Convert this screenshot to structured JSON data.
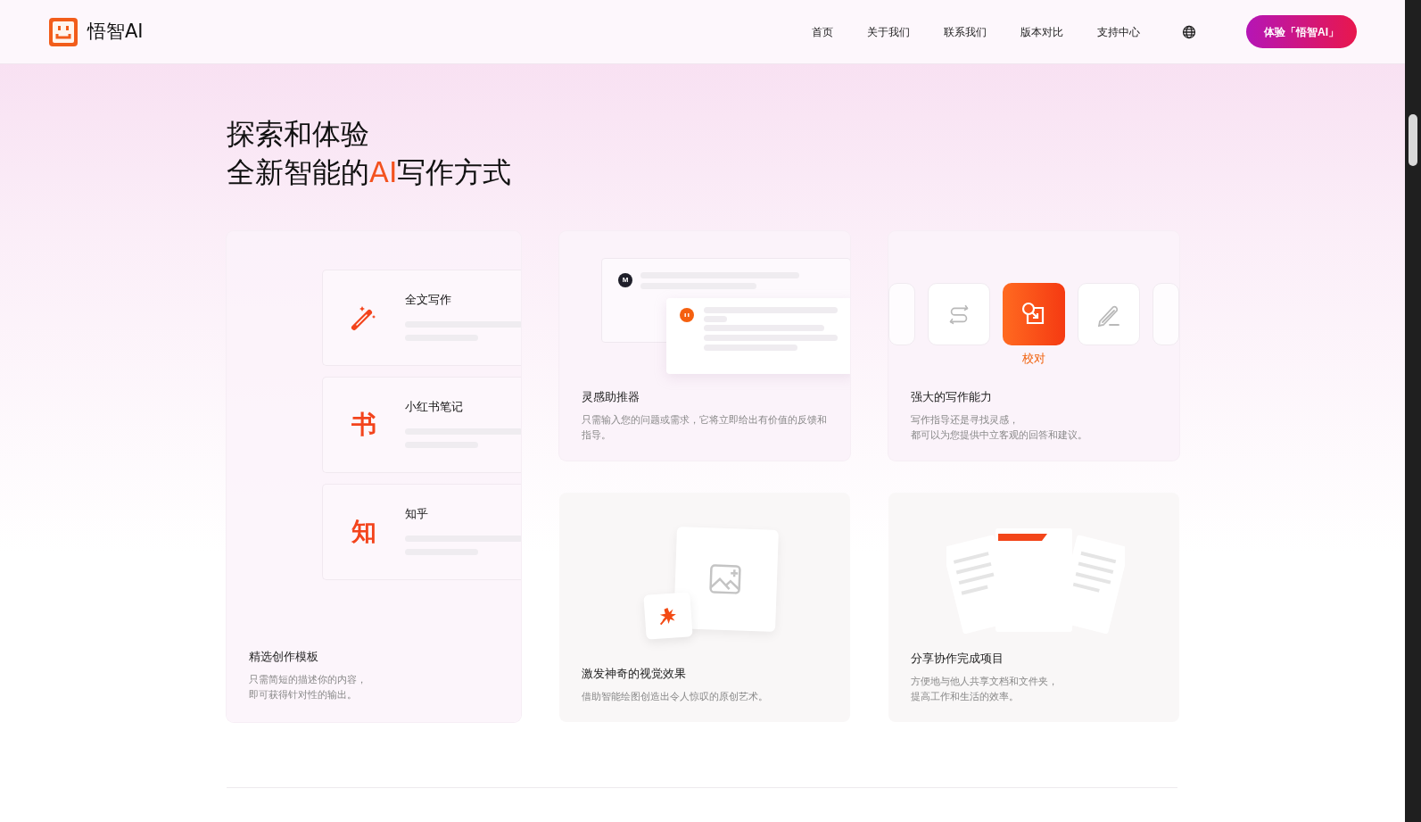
{
  "header": {
    "logo_text": "悟智AI",
    "nav": [
      {
        "label": "首页"
      },
      {
        "label": "关于我们"
      },
      {
        "label": "联系我们"
      },
      {
        "label": "版本对比"
      },
      {
        "label": "支持中心"
      }
    ],
    "cta": "体验「悟智AI」"
  },
  "hero": {
    "line1": "探索和体验",
    "line2_before": "全新智能的",
    "line2_highlight": "AI",
    "line2_after": "写作方式"
  },
  "cards": [
    {
      "kind": "templates",
      "title": "精选创作模板",
      "description": [
        "只需简短的描述你的内容，",
        "即可获得针对性的输出。"
      ],
      "templates": [
        {
          "kind": "wand",
          "label": "全文写作"
        },
        {
          "kind": "glyph",
          "glyph": "书",
          "label": "小红书笔记"
        },
        {
          "kind": "glyph",
          "glyph": "知",
          "label": "知乎"
        }
      ]
    },
    {
      "kind": "chat",
      "title": "灵感助推器",
      "description": [
        "只需输入您的问题或需求，它将立即给出有价值的反馈和指导。"
      ],
      "user_avatar": "M"
    },
    {
      "kind": "tools",
      "title": "强大的写作能力",
      "description": [
        "写作指导还是寻找灵感，",
        "都可以为您提供中立客观的回答和建议。"
      ],
      "tools": [
        {
          "kind": "edge",
          "selected": false
        },
        {
          "kind": "swap",
          "selected": false
        },
        {
          "kind": "proofread",
          "selected": true,
          "label": "校对"
        },
        {
          "kind": "pen",
          "selected": false
        },
        {
          "kind": "edge",
          "selected": false
        }
      ]
    },
    {
      "kind": "image",
      "title": "激发神奇的视觉效果",
      "description": [
        "借助智能绘图创造出令人惊叹的原创艺术。"
      ]
    },
    {
      "kind": "docs",
      "title": "分享协作完成项目",
      "description": [
        "方便地与他人共享文档和文件夹，",
        "提高工作和生活的效率。"
      ]
    }
  ]
}
